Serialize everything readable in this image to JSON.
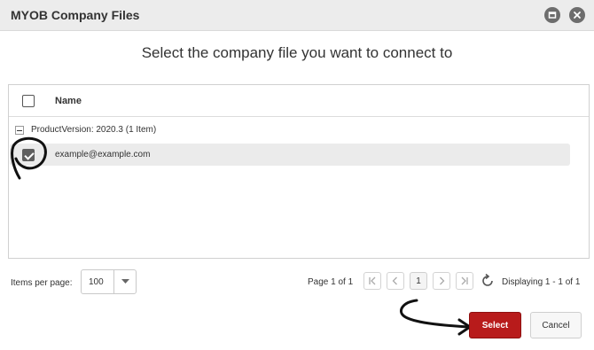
{
  "window": {
    "title": "MYOB Company Files",
    "restore_icon": "restore-icon",
    "close_icon": "close-icon"
  },
  "heading": "Select the company file you want to connect to",
  "grid": {
    "column_name": "Name",
    "group_label": "ProductVersion: 2020.3 (1 Item)",
    "rows": [
      {
        "name": "example@example.com",
        "checked": true
      }
    ]
  },
  "pager": {
    "items_per_page_label": "Items per page:",
    "items_per_page_value": "100",
    "page_label": "Page 1 of 1",
    "current_page": "1",
    "display_label": "Displaying 1 - 1 of 1"
  },
  "buttons": {
    "select": "Select",
    "cancel": "Cancel"
  },
  "colors": {
    "select_button": "#b81b1b",
    "titlebar": "#ececec",
    "selected_row": "#ebebeb"
  }
}
